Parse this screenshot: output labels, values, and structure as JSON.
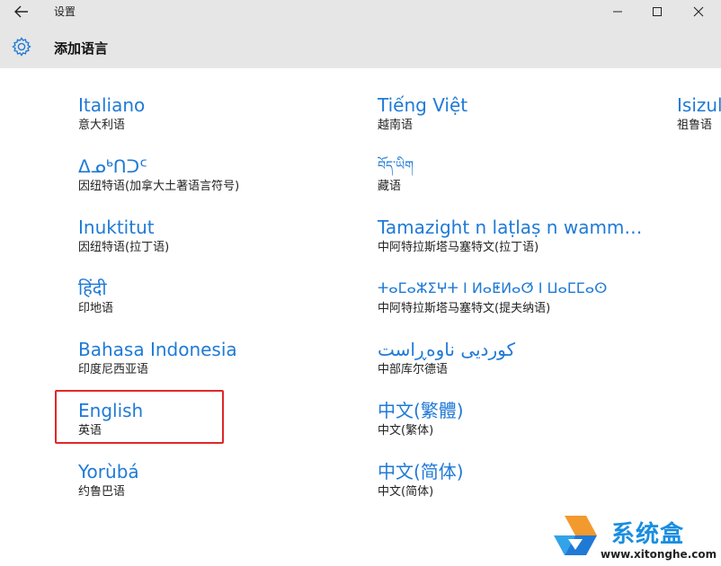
{
  "titlebar": {
    "app_title": "设置"
  },
  "page": {
    "title": "添加语言"
  },
  "languages": [
    {
      "native": "Italiano",
      "zh": "意大利语"
    },
    {
      "native": "ᐃᓄᒃᑎᑐᑦ",
      "zh": "因纽特语(加拿大土著语言符号)"
    },
    {
      "native": "Inuktitut",
      "zh": "因纽特语(拉丁语)"
    },
    {
      "native": "हिंदी",
      "zh": "印地语"
    },
    {
      "native": "Bahasa Indonesia",
      "zh": "印度尼西亚语"
    },
    {
      "native": "English",
      "zh": "英语"
    },
    {
      "native": "Yorùbá",
      "zh": "约鲁巴语"
    },
    {
      "native": "Tiếng Việt",
      "zh": "越南语"
    },
    {
      "native": "བོད་ཡིག",
      "zh": "藏语"
    },
    {
      "native": "Tamazight n laṭlaṣ n wamm…",
      "zh": "中阿特拉斯塔马塞特文(拉丁语)"
    },
    {
      "native": "ⵜⴰⵎⴰⵣⵉⵖⵜ ⵏ ⵍⴰⵟⵍⴰⵚ ⵏ ⵡⴰⵎⵎⴰⵙ",
      "zh": "中阿特拉斯塔马塞特文(提夫纳语)"
    },
    {
      "native": "کوردیی ناوەڕاست",
      "zh": "中部库尔德语"
    },
    {
      "native": "中文(繁體)",
      "zh": "中文(繁体)"
    },
    {
      "native": "中文(简体)",
      "zh": "中文(简体)"
    },
    {
      "native": "Isizulu",
      "zh": "祖鲁语"
    }
  ],
  "watermark": {
    "brand": "系统盒",
    "url": "www.xitonghe.com"
  }
}
